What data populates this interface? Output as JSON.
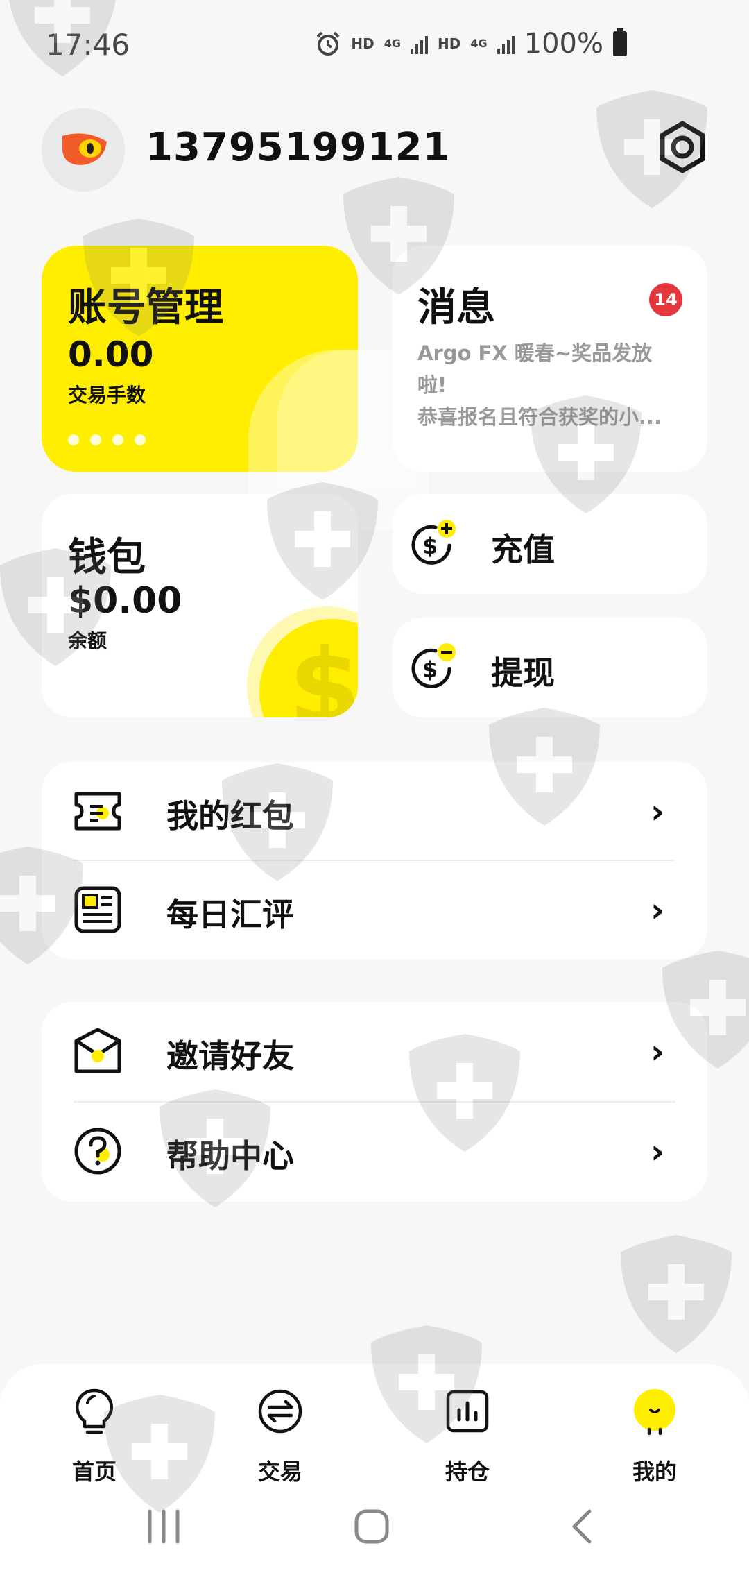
{
  "status_bar": {
    "time": "17:46",
    "hd1": "HD",
    "net1": "4G",
    "hd2": "HD",
    "net2": "4G",
    "battery": "100%",
    "icons": [
      "alarm-icon",
      "signal-icon",
      "battery-icon"
    ]
  },
  "header": {
    "phone": "13795199121",
    "avatar_icon": "eye-logo-icon",
    "settings_icon": "gear-icon"
  },
  "account_card": {
    "title": "账号管理",
    "value": "0.00",
    "subtitle": "交易手数",
    "page_dots": 4
  },
  "message_card": {
    "title": "消息",
    "badge": "14",
    "line1": "Argo FX 暖春~奖品发放",
    "line2": "啦!",
    "line3": "恭喜报名且符合获奖的小..."
  },
  "wallet_card": {
    "title": "钱包",
    "value": "$0.00",
    "subtitle": "余额",
    "coin_symbol": "$"
  },
  "actions": {
    "recharge": "充值",
    "withdraw": "提现"
  },
  "menu": {
    "group1": [
      {
        "label": "我的红包",
        "icon": "red-packet-icon",
        "chevron": "›"
      },
      {
        "label": "每日汇评",
        "icon": "news-icon",
        "chevron": "›"
      }
    ],
    "group2": [
      {
        "label": "邀请好友",
        "icon": "invite-envelope-icon",
        "chevron": "›"
      },
      {
        "label": "帮助中心",
        "icon": "help-icon",
        "chevron": "›"
      }
    ]
  },
  "bottom_nav": {
    "tabs": [
      {
        "label": "首页",
        "icon": "bulb-icon"
      },
      {
        "label": "交易",
        "icon": "exchange-icon"
      },
      {
        "label": "持仓",
        "icon": "chart-icon"
      },
      {
        "label": "我的",
        "icon": "profile-icon"
      }
    ],
    "active_index": 3
  },
  "colors": {
    "accent": "#ffee00",
    "badge": "#e5383b",
    "background": "#f7f7f7",
    "card": "#ffffff"
  }
}
